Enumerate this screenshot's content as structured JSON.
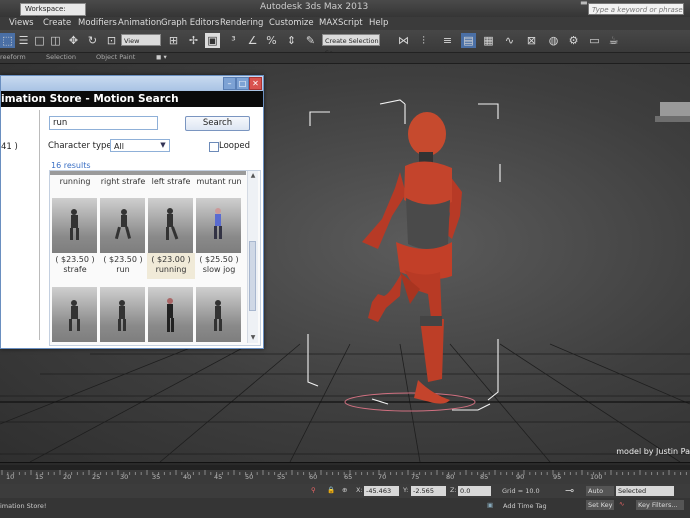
{
  "titlebar": {
    "workspace": "Workspace: Default",
    "title": "Autodesk 3ds Max 2013",
    "search_placeholder": "Type a keyword or phrase"
  },
  "menu": [
    "Views",
    "Create",
    "Modifiers",
    "Animation",
    "Graph Editors",
    "Rendering",
    "Customize",
    "MAXScript",
    "Help"
  ],
  "toolbar": {
    "view_select": "View",
    "selection_set": "Create Selection Se"
  },
  "ribbon": [
    "reeform",
    "Selection",
    "Object Paint"
  ],
  "dialog": {
    "title": "imation Store - Motion Search",
    "left_count": "41 )",
    "search_value": "run",
    "search_button": "Search",
    "character_type_label": "Character type",
    "character_type_value": "All",
    "looped_label": "Looped",
    "results": "16 results",
    "top_row": [
      "running",
      "right strafe",
      "left strafe",
      "mutant run"
    ],
    "cards": [
      {
        "price": "( $23.50 )",
        "name": "strafe"
      },
      {
        "price": "( $23.50 )",
        "name": "run"
      },
      {
        "price": "( $23.00 )",
        "name": "running"
      },
      {
        "price": "( $25.50 )",
        "name": "slow jog"
      }
    ]
  },
  "viewport": {
    "credit": "model by Justin Pa"
  },
  "timeline": {
    "ticks": [
      "10",
      "15",
      "20",
      "25",
      "30",
      "35",
      "40",
      "45",
      "50",
      "55",
      "60",
      "65",
      "70",
      "75",
      "80",
      "85",
      "90",
      "95",
      "100"
    ]
  },
  "status": {
    "x_label": "X:",
    "x_value": "-45.463",
    "y_label": "Y:",
    "y_value": "-2.565",
    "z_label": "Z:",
    "z_value": "0.0",
    "grid": "Grid = 10.0",
    "auto_key": "Auto Key",
    "selected": "Selected",
    "set_key": "Set Key",
    "key_filters": "Key Filters...",
    "add_time_tag": "Add Time Tag",
    "message": "imation Store!"
  }
}
